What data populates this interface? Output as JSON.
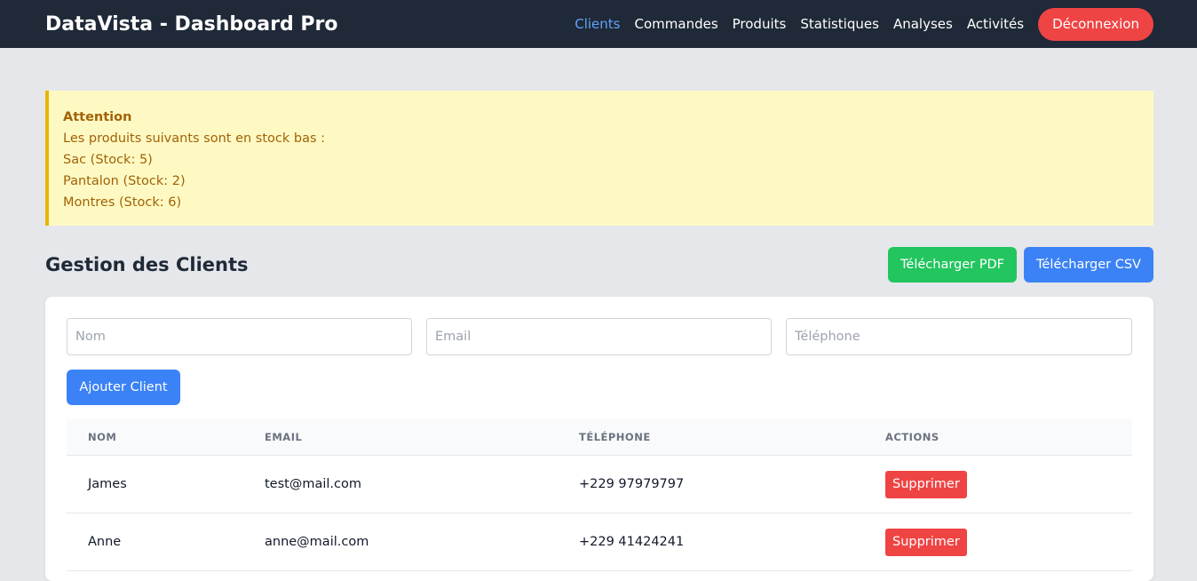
{
  "app": {
    "title": "DataVista - Dashboard Pro"
  },
  "nav": {
    "items": [
      {
        "label": "Clients",
        "active": true
      },
      {
        "label": "Commandes"
      },
      {
        "label": "Produits"
      },
      {
        "label": "Statistiques"
      },
      {
        "label": "Analyses"
      },
      {
        "label": "Activités"
      }
    ],
    "logout_label": "Déconnexion"
  },
  "alert": {
    "title": "Attention",
    "message": "Les produits suivants sont en stock bas :",
    "items": [
      "Sac (Stock: 5)",
      "Pantalon (Stock: 2)",
      "Montres (Stock: 6)"
    ]
  },
  "section": {
    "title": "Gestion des Clients",
    "pdf_label": "Télécharger PDF",
    "csv_label": "Télécharger CSV"
  },
  "form": {
    "nom_placeholder": "Nom",
    "email_placeholder": "Email",
    "tel_placeholder": "Téléphone",
    "add_label": "Ajouter Client"
  },
  "table": {
    "headers": [
      "Nom",
      "Email",
      "Téléphone",
      "Actions"
    ],
    "rows": [
      {
        "nom": "James",
        "email": "test@mail.com",
        "tel": "+229 97979797",
        "action": "Supprimer"
      },
      {
        "nom": "Anne",
        "email": "anne@mail.com",
        "tel": "+229 41424241",
        "action": "Supprimer"
      }
    ]
  },
  "colors": {
    "nav_bg": "#1f2937",
    "accent": "#3b82f6",
    "success": "#22c55e",
    "danger": "#ef4444",
    "warning_bg": "#fef9c3"
  }
}
